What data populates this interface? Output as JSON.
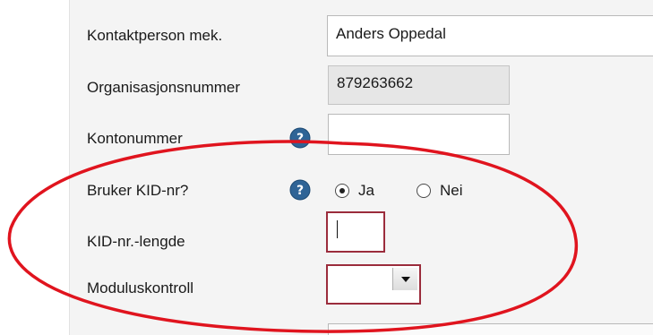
{
  "form": {
    "contact_person": {
      "label": "Kontaktperson mek.",
      "value": "Anders Oppedal"
    },
    "org_number": {
      "label": "Organisasjonsnummer",
      "value": "879263662"
    },
    "account_number": {
      "label": "Kontonummer",
      "value": "",
      "help_icon": "question-circle-icon"
    },
    "uses_kid": {
      "label": "Bruker KID-nr?",
      "help_icon": "question-circle-icon",
      "options": [
        {
          "label": "Ja",
          "selected": true
        },
        {
          "label": "Nei",
          "selected": false
        }
      ]
    },
    "kid_length": {
      "label": "KID-nr.-lengde",
      "value": "",
      "state": "invalid"
    },
    "modulus_control": {
      "label": "Moduluskontroll",
      "value": "",
      "state": "invalid"
    }
  },
  "colors": {
    "annotation_ellipse": "#e0141e",
    "invalid_border": "#9b2c3c",
    "help_icon": "#2f6496"
  }
}
